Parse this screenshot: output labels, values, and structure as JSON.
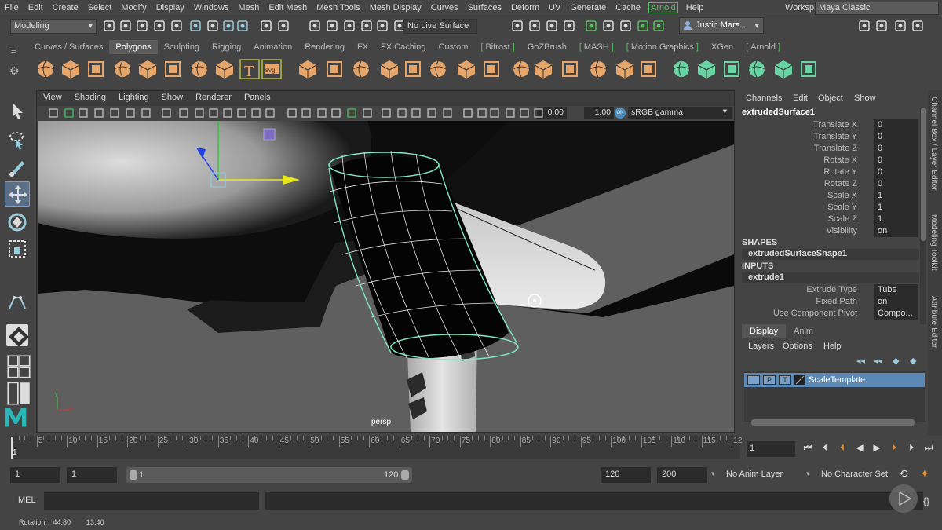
{
  "menubar": {
    "items": [
      "File",
      "Edit",
      "Create",
      "Select",
      "Modify",
      "Display",
      "Windows",
      "Mesh",
      "Edit Mesh",
      "Mesh Tools",
      "Mesh Display",
      "Curves",
      "Surfaces",
      "Deform",
      "UV",
      "Generate",
      "Cache",
      "Arnold",
      "Help"
    ],
    "workspace_label": "Workspace :",
    "workspace_value": "Maya Classic"
  },
  "statusline": {
    "mode": "Modeling",
    "live_surface": "No Live Surface",
    "user": "Justin Mars..."
  },
  "shelf_tabs": [
    "Curves / Surfaces",
    "Polygons",
    "Sculpting",
    "Rigging",
    "Animation",
    "Rendering",
    "FX",
    "FX Caching",
    "Custom",
    "Bifrost",
    "GoZBrush",
    "MASH",
    "Motion Graphics",
    "XGen",
    "Arnold"
  ],
  "shelf_active": "Polygons",
  "shelf_icons": [
    "poly-sphere-icon",
    "poly-cube-icon",
    "poly-cylinder-icon",
    "poly-cone-icon",
    "poly-plane-icon",
    "poly-torus-icon",
    "poly-prism-icon",
    "poly-pipe-icon",
    "type-tool-icon",
    "svg-tool-icon",
    "combine-icon",
    "separate-icon",
    "extract-icon",
    "smooth-icon",
    "boolean-icon",
    "mirror-icon",
    "multi-cut-icon",
    "bridge-icon",
    "extrude-icon",
    "bevel-icon",
    "fill-hole-icon",
    "insert-edgeloop-icon",
    "offset-edgeloop-icon",
    "target-weld-icon",
    "uv-planar-icon",
    "uv-cylindrical-icon",
    "uv-spherical-icon",
    "uv-automatic-icon",
    "uv-editor-icon",
    "uv-layout-icon"
  ],
  "viewport": {
    "menu": [
      "View",
      "Shading",
      "Lighting",
      "Show",
      "Renderer",
      "Panels"
    ],
    "exposure": "0.00",
    "gamma": "1.00",
    "color_space": "sRGB gamma",
    "camera_label": "persp"
  },
  "channel_box": {
    "menu": [
      "Channels",
      "Edit",
      "Object",
      "Show"
    ],
    "object_name": "extrudedSurface1",
    "attributes": [
      {
        "label": "Translate X",
        "value": "0"
      },
      {
        "label": "Translate Y",
        "value": "0"
      },
      {
        "label": "Translate Z",
        "value": "0"
      },
      {
        "label": "Rotate X",
        "value": "0"
      },
      {
        "label": "Rotate Y",
        "value": "0"
      },
      {
        "label": "Rotate Z",
        "value": "0"
      },
      {
        "label": "Scale X",
        "value": "1"
      },
      {
        "label": "Scale Y",
        "value": "1"
      },
      {
        "label": "Scale Z",
        "value": "1"
      },
      {
        "label": "Visibility",
        "value": "on"
      }
    ],
    "shapes_header": "SHAPES",
    "shape_node": "extrudedSurfaceShape1",
    "inputs_header": "INPUTS",
    "input_node": "extrude1",
    "input_attributes": [
      {
        "label": "Extrude Type",
        "value": "Tube"
      },
      {
        "label": "Fixed Path",
        "value": "on"
      },
      {
        "label": "Use Component Pivot",
        "value": "Compo..."
      }
    ]
  },
  "layer_editor": {
    "tabs": [
      "Display",
      "Anim"
    ],
    "active_tab": "Display",
    "menu": [
      "Layers",
      "Options",
      "Help"
    ],
    "layers": [
      {
        "name": "ScaleTemplate",
        "flags": [
          "",
          "P",
          "T"
        ]
      }
    ]
  },
  "side_tabs": [
    "Channel Box / Layer Editor",
    "Modeling Toolkit",
    "Attribute Editor"
  ],
  "timeline": {
    "ticks": [
      "5",
      "10",
      "15",
      "20",
      "25",
      "30",
      "35",
      "40",
      "45",
      "50",
      "55",
      "60",
      "65",
      "70",
      "75",
      "80",
      "85",
      "90",
      "95",
      "100",
      "105",
      "110",
      "115",
      "12"
    ],
    "current_frame": "1",
    "current_frame_field": "1"
  },
  "range": {
    "start": "1",
    "playback_start": "1",
    "slider_start": "1",
    "slider_end": "120",
    "playback_end": "120",
    "end": "200",
    "anim_layer": "No Anim Layer",
    "character_set": "No Character Set"
  },
  "cmdline": {
    "label": "MEL"
  },
  "helpline": {
    "text": "Rotation:   44.80        13.40"
  },
  "colors": {
    "accent": "#5b88b4",
    "arnold_green": "#4fc35a",
    "shelf_orange": "#e8a56a",
    "mesh_green": "#7fe8c0"
  }
}
